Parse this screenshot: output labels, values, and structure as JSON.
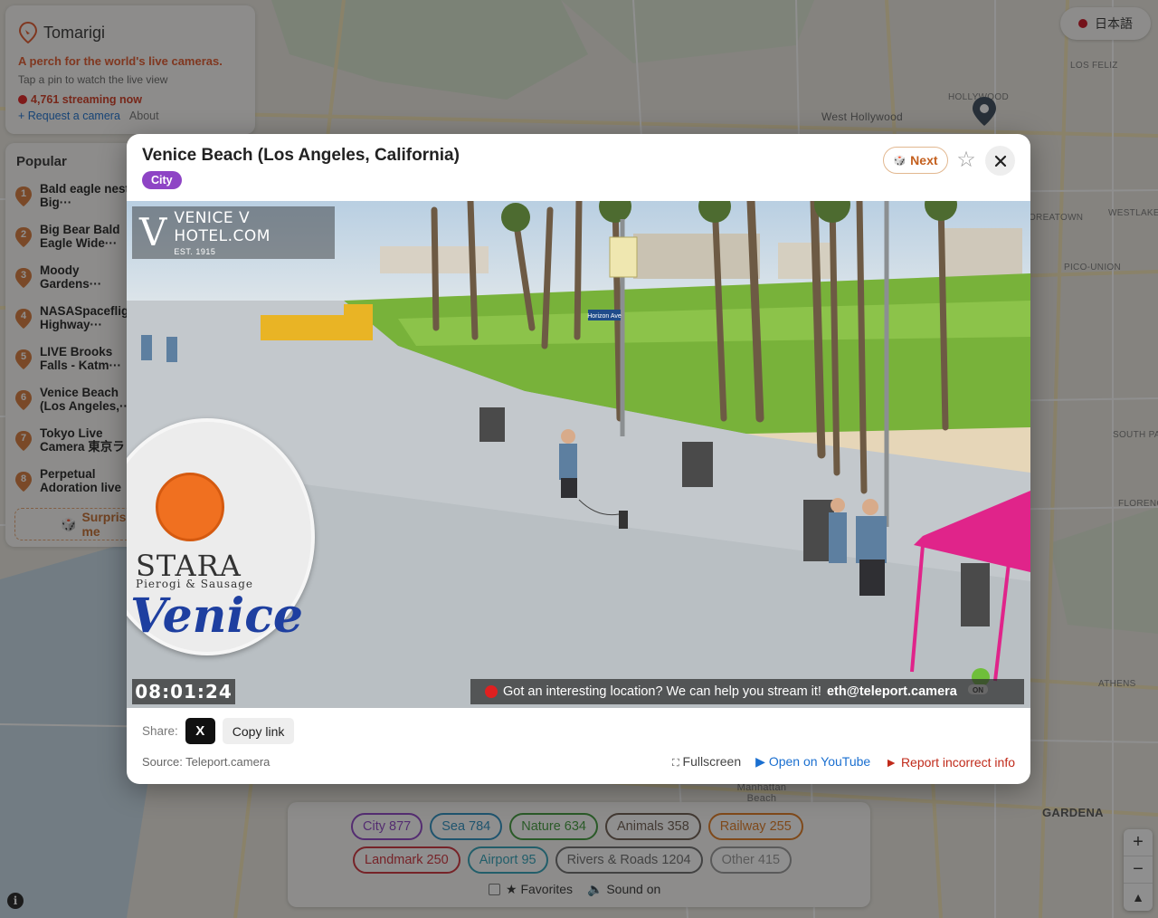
{
  "brand": {
    "name": "Tomarigi",
    "tagline": "A perch for the world's live cameras.",
    "hint": "Tap a pin to watch the live view",
    "streaming": "4,761 streaming now",
    "request_link": "+ Request a camera",
    "about_link": "About"
  },
  "language": {
    "label": "日本語"
  },
  "popular": {
    "title": "Popular",
    "items": [
      {
        "rank": "1",
        "label": "Bald eagle nest / Big···"
      },
      {
        "rank": "2",
        "label": "Big Bear Bald Eagle Wide···"
      },
      {
        "rank": "3",
        "label": "Moody Gardens···"
      },
      {
        "rank": "4",
        "label": "NASASpaceflight Highway···"
      },
      {
        "rank": "5",
        "label": "LIVE Brooks Falls - Katm···"
      },
      {
        "rank": "6",
        "label": "Venice Beach (Los Angeles,···"
      },
      {
        "rank": "7",
        "label": "Tokyo Live Camera 東京ラ"
      },
      {
        "rank": "8",
        "label": "Perpetual Adoration live"
      }
    ],
    "surprise_label": "Surprise me"
  },
  "map_labels": {
    "los_feliz": "LOS FELIZ",
    "hollywood": "HOLLYWOOD",
    "west_hollywood": "West Hollywood",
    "koreatown": "KOREATOWN",
    "westlake": "WESTLAKE",
    "pico_union": "PICO-UNION",
    "south_park": "SOUTH PARK",
    "florence": "FLORENCE",
    "athens": "ATHENS",
    "gardena": "GARDENA",
    "manhattan_beach": "Manhattan Beach"
  },
  "modal": {
    "title": "Venice Beach (Los Angeles, California)",
    "tag": "City",
    "next_label": "Next",
    "video": {
      "watermark_title": "VENICE V HOTEL.COM",
      "watermark_est": "EST. 1915",
      "timestamp": "08:01:24",
      "banner_text": "Got an interesting location? We can help you stream it!",
      "banner_email": "eth@teleport.camera",
      "stara_word": "STARA",
      "stara_sub": "Pierogi & Sausage",
      "stara_venice": "Venice",
      "street_sign": "Horizon Ave",
      "badge_on": "ON"
    },
    "share_label": "Share:",
    "x_label": "X",
    "copy_label": "Copy link",
    "source": "Source: Teleport.camera",
    "fullscreen_label": "Fullscreen",
    "youtube_label": "Open on YouTube",
    "report_label": "Report incorrect info"
  },
  "filters": {
    "row1": [
      {
        "label": "City 877",
        "color": "#8e44c5"
      },
      {
        "label": "Sea 784",
        "color": "#2a8fc0"
      },
      {
        "label": "Nature 634",
        "color": "#3f9a3a"
      },
      {
        "label": "Animals 358",
        "color": "#6b5a4e"
      },
      {
        "label": "Railway 255",
        "color": "#e07a20"
      }
    ],
    "row2": [
      {
        "label": "Landmark 250",
        "color": "#d0303a"
      },
      {
        "label": "Airport 95",
        "color": "#2fa2b8"
      },
      {
        "label": "Rivers & Roads 1204",
        "color": "#6b6b6b"
      },
      {
        "label": "Other 415",
        "color": "#999999"
      }
    ],
    "favorites_label": "★ Favorites",
    "sound_label": "Sound on"
  },
  "zoom": {
    "plus": "+",
    "minus": "−",
    "compass": "▲"
  },
  "info_label": "i"
}
